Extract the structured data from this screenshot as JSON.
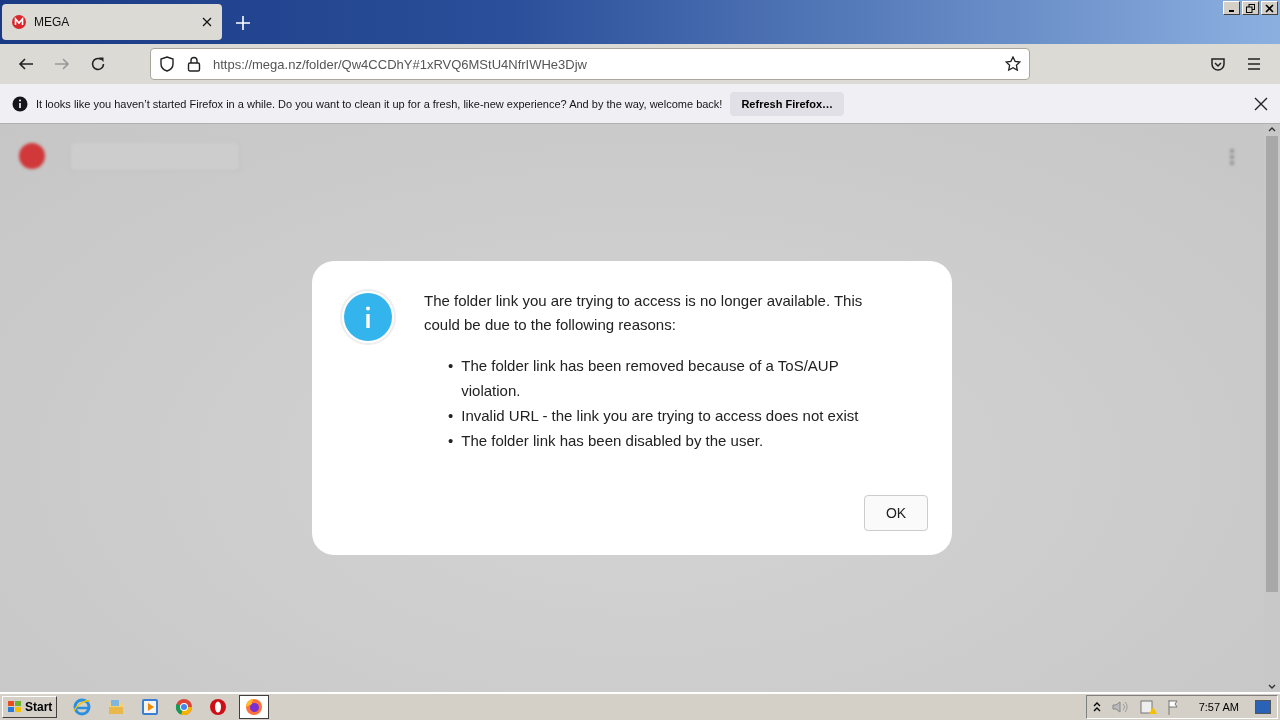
{
  "browser": {
    "tabs": [
      {
        "title": "MEGA",
        "selected": true
      }
    ],
    "url": "https://mega.nz/folder/Qw4CCDhY#1xRVQ6MStU4NfrIWHe3Djw",
    "notification": {
      "message": "It looks like you haven’t started Firefox in a while. Do you want to clean it up for a fresh, like-new experience? And by the way, welcome back!",
      "button": "Refresh Firefox…"
    }
  },
  "dialog": {
    "message": "The folder link you are trying to access is no longer available. This could be due to the following reasons:",
    "reasons": [
      {
        "bullet": "•",
        "text": "The folder link has been removed because of a ToS/AUP violation."
      },
      {
        "bullet": "•",
        "text": "Invalid URL - the link you are trying to access does not exist"
      },
      {
        "bullet": "•",
        "text": "The folder link has been disabled by the user."
      }
    ],
    "button": "OK"
  },
  "taskbar": {
    "start": "Start",
    "apps": [
      {
        "kind": "ie",
        "selected": false
      },
      {
        "kind": "explorer",
        "selected": false
      },
      {
        "kind": "media",
        "selected": false
      },
      {
        "kind": "chrome",
        "selected": false
      },
      {
        "kind": "opera",
        "selected": false
      },
      {
        "kind": "firefox",
        "selected": true
      }
    ],
    "clock": "7:57 AM"
  }
}
